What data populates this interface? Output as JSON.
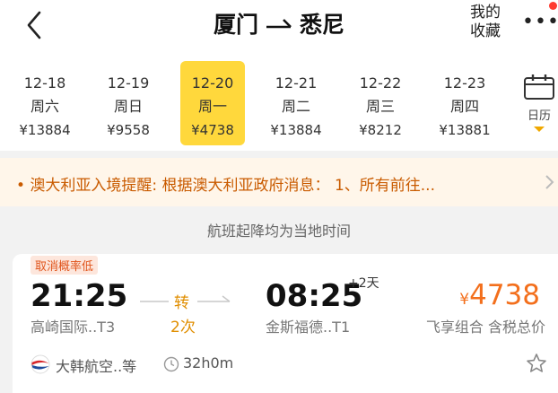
{
  "header": {
    "from": "厦门",
    "to": "悉尼",
    "favorite_line1": "我的",
    "favorite_line2": "收藏",
    "more": "•••"
  },
  "dates": [
    {
      "date": "12-18",
      "weekday": "周六",
      "price": "¥13884",
      "selected": false
    },
    {
      "date": "12-19",
      "weekday": "周日",
      "price": "¥9558",
      "selected": false
    },
    {
      "date": "12-20",
      "weekday": "周一",
      "price": "¥4738",
      "selected": true
    },
    {
      "date": "12-21",
      "weekday": "周二",
      "price": "¥13884",
      "selected": false
    },
    {
      "date": "12-22",
      "weekday": "周三",
      "price": "¥8212",
      "selected": false
    },
    {
      "date": "12-23",
      "weekday": "周四",
      "price": "¥13881",
      "selected": false
    }
  ],
  "calendar_label": "日历",
  "notice": "• 澳大利亚入境提醒: 根据澳大利亚政府消息： 1、所有前往...",
  "info": "航班起降均为当地时间",
  "flight": {
    "badge": "取消概率低",
    "dep_time": "21:25",
    "dep_airport": "高崎国际..T3",
    "transfer_label": "转",
    "transfer_count": "2次",
    "arr_time": "08:25",
    "plus_day": "+2天",
    "arr_airport": "金斯福德..T1",
    "currency": "¥",
    "price": "4738",
    "price_note": "飞享组合 含税总价",
    "airline": "大韩航空..等",
    "duration": "32h0m"
  },
  "colors": {
    "accent": "#ffd83c",
    "price": "#f36f1c",
    "notice_text": "#c95b00",
    "transfer": "#e08e00"
  }
}
